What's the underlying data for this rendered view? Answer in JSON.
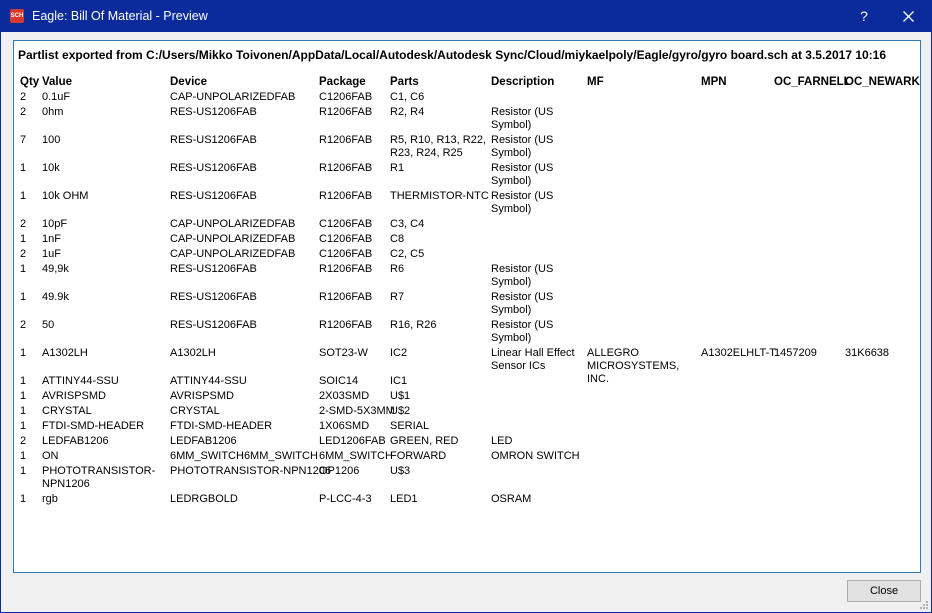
{
  "window": {
    "icon_text": "SCH",
    "title": "Eagle: Bill Of Material - Preview",
    "help_label": "?"
  },
  "heading": "Partlist exported from C:/Users/Mikko Toivonen/AppData/Local/Autodesk/Autodesk Sync/Cloud/miykaelpoly/Eagle/gyro/gyro board.sch at 3.5.2017 10:16",
  "columns": [
    "Qty",
    "Value",
    "Device",
    "Package",
    "Parts",
    "Description",
    "MF",
    "MPN",
    "OC_FARNELL",
    "OC_NEWARK"
  ],
  "rows": [
    {
      "qty": "2",
      "value": "0.1uF",
      "device": "CAP-UNPOLARIZEDFAB",
      "package": "C1206FAB",
      "parts": "C1, C6",
      "description": "",
      "mf": "",
      "mpn": "",
      "farnell": "",
      "newark": ""
    },
    {
      "qty": "2",
      "value": "0hm",
      "device": "RES-US1206FAB",
      "package": "R1206FAB",
      "parts": "R2, R4",
      "description": "Resistor (US Symbol)",
      "mf": "",
      "mpn": "",
      "farnell": "",
      "newark": ""
    },
    {
      "qty": "7",
      "value": "100",
      "device": "RES-US1206FAB",
      "package": "R1206FAB",
      "parts": "R5, R10, R13, R22, R23, R24, R25",
      "description": "Resistor (US Symbol)",
      "mf": "",
      "mpn": "",
      "farnell": "",
      "newark": ""
    },
    {
      "qty": "1",
      "value": "10k",
      "device": "RES-US1206FAB",
      "package": "R1206FAB",
      "parts": "R1",
      "description": "Resistor (US Symbol)",
      "mf": "",
      "mpn": "",
      "farnell": "",
      "newark": ""
    },
    {
      "qty": "1",
      "value": "10k OHM",
      "device": "RES-US1206FAB",
      "package": "R1206FAB",
      "parts": "THERMISTOR-NTC",
      "description": "Resistor (US Symbol)",
      "mf": "",
      "mpn": "",
      "farnell": "",
      "newark": ""
    },
    {
      "qty": "2",
      "value": "10pF",
      "device": "CAP-UNPOLARIZEDFAB",
      "package": "C1206FAB",
      "parts": "C3, C4",
      "description": "",
      "mf": "",
      "mpn": "",
      "farnell": "",
      "newark": ""
    },
    {
      "qty": "1",
      "value": "1nF",
      "device": "CAP-UNPOLARIZEDFAB",
      "package": "C1206FAB",
      "parts": "C8",
      "description": "",
      "mf": "",
      "mpn": "",
      "farnell": "",
      "newark": ""
    },
    {
      "qty": "2",
      "value": "1uF",
      "device": "CAP-UNPOLARIZEDFAB",
      "package": "C1206FAB",
      "parts": "C2, C5",
      "description": "",
      "mf": "",
      "mpn": "",
      "farnell": "",
      "newark": ""
    },
    {
      "qty": "1",
      "value": "49,9k",
      "device": "RES-US1206FAB",
      "package": "R1206FAB",
      "parts": "R6",
      "description": "Resistor (US Symbol)",
      "mf": "",
      "mpn": "",
      "farnell": "",
      "newark": ""
    },
    {
      "qty": "1",
      "value": "49.9k",
      "device": "RES-US1206FAB",
      "package": "R1206FAB",
      "parts": "R7",
      "description": "Resistor (US Symbol)",
      "mf": "",
      "mpn": "",
      "farnell": "",
      "newark": ""
    },
    {
      "qty": "2",
      "value": "50",
      "device": "RES-US1206FAB",
      "package": "R1206FAB",
      "parts": "R16, R26",
      "description": "Resistor (US Symbol)",
      "mf": "",
      "mpn": "",
      "farnell": "",
      "newark": ""
    },
    {
      "qty": "1",
      "value": "A1302LH",
      "device": "A1302LH",
      "package": "SOT23-W",
      "parts": "IC2",
      "description": "Linear Hall Effect Sensor ICs",
      "mf": "ALLEGRO MICROSYSTEMS, INC.",
      "mpn": "A1302ELHLT-T",
      "farnell": "1457209",
      "newark": "31K6638"
    },
    {
      "qty": "1",
      "value": "ATTINY44-SSU",
      "device": "ATTINY44-SSU",
      "package": "SOIC14",
      "parts": "IC1",
      "description": "",
      "mf": "",
      "mpn": "",
      "farnell": "",
      "newark": ""
    },
    {
      "qty": "1",
      "value": "AVRISPSMD",
      "device": "AVRISPSMD",
      "package": "2X03SMD",
      "parts": "U$1",
      "description": "",
      "mf": "",
      "mpn": "",
      "farnell": "",
      "newark": ""
    },
    {
      "qty": "1",
      "value": "CRYSTAL",
      "device": "CRYSTAL",
      "package": "2-SMD-5X3MM",
      "parts": "U$2",
      "description": "",
      "mf": "",
      "mpn": "",
      "farnell": "",
      "newark": ""
    },
    {
      "qty": "1",
      "value": "FTDI-SMD-HEADER",
      "device": "FTDI-SMD-HEADER",
      "package": "1X06SMD",
      "parts": "SERIAL",
      "description": "",
      "mf": "",
      "mpn": "",
      "farnell": "",
      "newark": ""
    },
    {
      "qty": "2",
      "value": "LEDFAB1206",
      "device": "LEDFAB1206",
      "package": "LED1206FAB",
      "parts": "GREEN, RED",
      "description": "LED",
      "mf": "",
      "mpn": "",
      "farnell": "",
      "newark": ""
    },
    {
      "qty": "1",
      "value": "ON",
      "device": "6MM_SWITCH6MM_SWITCH",
      "package": "6MM_SWITCH",
      "parts": "FORWARD",
      "description": "OMRON SWITCH",
      "mf": "",
      "mpn": "",
      "farnell": "",
      "newark": ""
    },
    {
      "qty": "1",
      "value": "PHOTOTRANSISTOR-NPN1206",
      "device": "PHOTOTRANSISTOR-NPN1206",
      "package": "OP1206",
      "parts": "U$3",
      "description": "",
      "mf": "",
      "mpn": "",
      "farnell": "",
      "newark": ""
    },
    {
      "qty": "1",
      "value": "rgb",
      "device": "LEDRGBOLD",
      "package": "P-LCC-4-3",
      "parts": "LED1",
      "description": "OSRAM",
      "mf": "",
      "mpn": "",
      "farnell": "",
      "newark": ""
    }
  ],
  "buttons": {
    "close_label": "Close"
  },
  "colors": {
    "titlebar": "#0b2a9c",
    "panel_border": "#2f7ab3",
    "background": "#f0f0f0"
  }
}
